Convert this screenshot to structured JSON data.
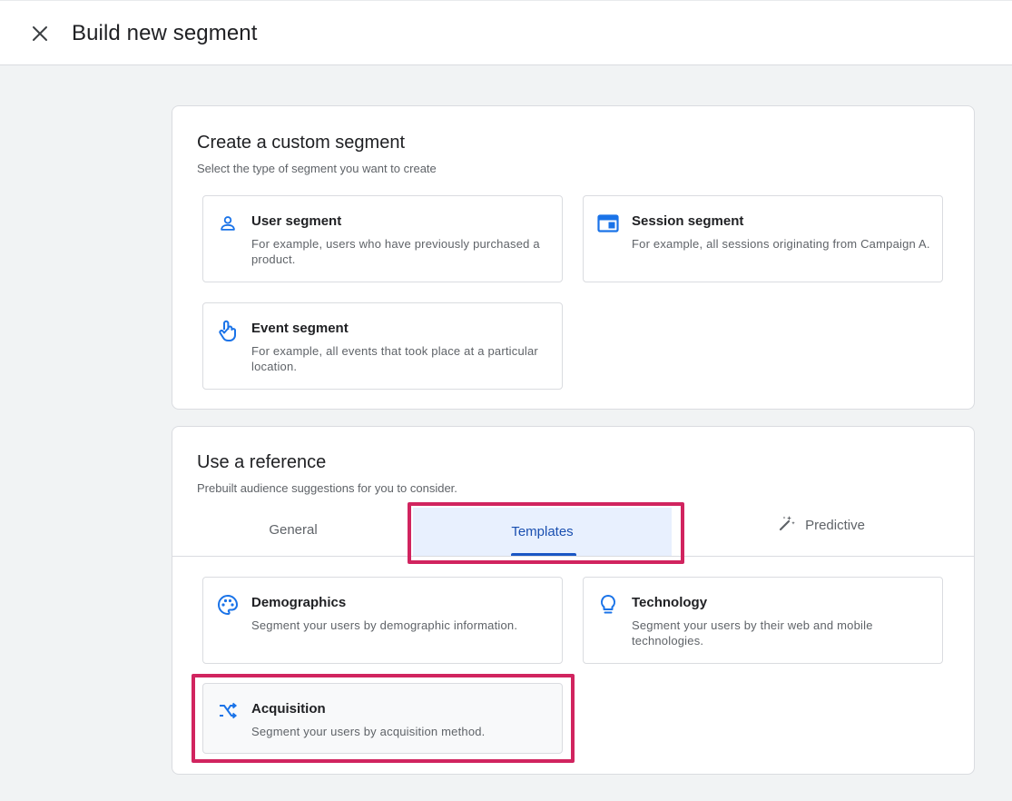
{
  "header": {
    "title": "Build new segment",
    "close_icon": "close-icon"
  },
  "custom_segment": {
    "title": "Create a custom segment",
    "subtitle": "Select the type of segment you want to create",
    "options": [
      {
        "title": "User segment",
        "description": "For example, users who have previously purchased a product.",
        "icon": "person-icon"
      },
      {
        "title": "Session segment",
        "description": "For example, all sessions originating from Campaign A.",
        "icon": "session-icon"
      },
      {
        "title": "Event segment",
        "description": "For example, all events that took place at a particular location.",
        "icon": "touch-icon"
      }
    ]
  },
  "reference": {
    "title": "Use a reference",
    "subtitle": "Prebuilt audience suggestions for you to consider.",
    "tabs": [
      {
        "label": "General",
        "selected": false
      },
      {
        "label": "Templates",
        "selected": true
      },
      {
        "label": "Predictive",
        "selected": false,
        "icon": "magic-wand-icon"
      }
    ],
    "templates": [
      {
        "title": "Demographics",
        "description": "Segment your users by demographic information.",
        "icon": "palette-icon"
      },
      {
        "title": "Technology",
        "description": "Segment your users by their web and mobile technologies.",
        "icon": "lightbulb-icon"
      },
      {
        "title": "Acquisition",
        "description": "Segment your users by acquisition method.",
        "icon": "shuffle-icon"
      }
    ]
  },
  "colors": {
    "accent": "#1a73e8",
    "highlight": "#d1245f",
    "selected_tab_bg": "#e8f0fe"
  }
}
